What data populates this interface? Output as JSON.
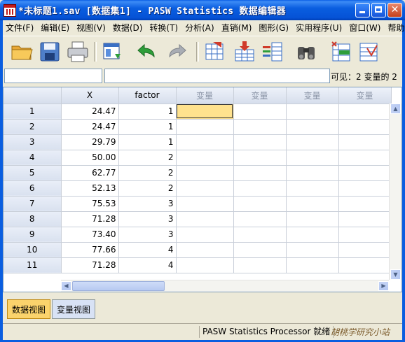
{
  "window": {
    "title": "*未标题1.sav [数据集1] - PASW Statistics 数据编辑器",
    "minimize": "_",
    "close": "✕"
  },
  "menu": [
    "文件(F)",
    "编辑(E)",
    "视图(V)",
    "数据(D)",
    "转换(T)",
    "分析(A)",
    "直销(M)",
    "图形(G)",
    "实用程序(U)",
    "窗口(W)",
    "帮助"
  ],
  "toolbar": {
    "icons": [
      "open-folder-icon",
      "save-icon",
      "print-icon",
      "dialog-recall-icon",
      "undo-icon",
      "redo-icon",
      "goto-case-icon",
      "goto-variable-icon",
      "variables-icon",
      "find-icon",
      "insert-cases-icon",
      "split-file-icon"
    ]
  },
  "editor": {
    "cell_ref": "",
    "cell_value": "",
    "visible_label": "可见：2 变量的 2"
  },
  "grid": {
    "columns": [
      "X",
      "factor",
      "变量",
      "变量",
      "变量",
      "变量"
    ],
    "rows": [
      {
        "n": "1",
        "x": "24.47",
        "factor": "1"
      },
      {
        "n": "2",
        "x": "24.47",
        "factor": "1"
      },
      {
        "n": "3",
        "x": "29.79",
        "factor": "1"
      },
      {
        "n": "4",
        "x": "50.00",
        "factor": "2"
      },
      {
        "n": "5",
        "x": "62.77",
        "factor": "2"
      },
      {
        "n": "6",
        "x": "52.13",
        "factor": "2"
      },
      {
        "n": "7",
        "x": "75.53",
        "factor": "3"
      },
      {
        "n": "8",
        "x": "71.28",
        "factor": "3"
      },
      {
        "n": "9",
        "x": "73.40",
        "factor": "3"
      },
      {
        "n": "10",
        "x": "77.66",
        "factor": "4"
      },
      {
        "n": "11",
        "x": "71.28",
        "factor": "4"
      }
    ],
    "selected_cell": {
      "row": 1,
      "column": 3
    },
    "selected_color": "#ffe28e"
  },
  "tabs": {
    "data_view": "数据视图",
    "variable_view": "变量视图",
    "active_color": "#fbd36c"
  },
  "status": {
    "processor": "PASW Statistics Processor 就绪",
    "watermark": "胡桃学研究小站"
  }
}
